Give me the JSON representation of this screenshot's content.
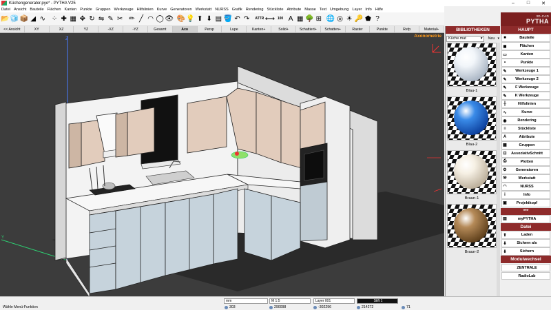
{
  "window": {
    "title": "Küchengenerator.pyo* - PYTHA V25",
    "controls": [
      "–",
      "□",
      "✕"
    ]
  },
  "menu": [
    "Datei",
    "Ansicht",
    "Bauteile",
    "Flächen",
    "Kanten",
    "Punkte",
    "Gruppen",
    "Werkzeuge",
    "Hilfslinien",
    "Kurve",
    "Generatoren",
    "Werkstatt",
    "NURSS",
    "Grafik",
    "Rendering",
    "Stückliste",
    "Attribute",
    "Masse",
    "Text",
    "Umgebung",
    "Layer",
    "Info",
    "Hilfe"
  ],
  "toolbar": [
    {
      "name": "open-icon",
      "glyph": "📂"
    },
    {
      "name": "cube-icon",
      "glyph": "🧊"
    },
    {
      "name": "box-icon",
      "glyph": "📦"
    },
    {
      "name": "surface-icon",
      "glyph": "◢"
    },
    {
      "name": "curve-icon",
      "glyph": "∿"
    },
    {
      "name": "sep"
    },
    {
      "name": "points-icon",
      "glyph": "⁘"
    },
    {
      "name": "snap-icon",
      "glyph": "✚"
    },
    {
      "name": "group-icon",
      "glyph": "▦"
    },
    {
      "name": "move-icon",
      "glyph": "✥"
    },
    {
      "name": "rotate-icon",
      "glyph": "↻"
    },
    {
      "name": "mirror-icon",
      "glyph": "⇋"
    },
    {
      "name": "edit-icon",
      "glyph": "✎"
    },
    {
      "name": "cut-icon",
      "glyph": "✂"
    },
    {
      "name": "sep"
    },
    {
      "name": "pencil-icon",
      "glyph": "✏"
    },
    {
      "name": "line-icon",
      "glyph": "╱"
    },
    {
      "name": "arc-icon",
      "glyph": "◠"
    },
    {
      "name": "circle-icon",
      "glyph": "◯"
    },
    {
      "name": "eye-icon",
      "glyph": "👁"
    },
    {
      "name": "sep"
    },
    {
      "name": "render-icon",
      "glyph": "🎨"
    },
    {
      "name": "light-icon",
      "glyph": "💡"
    },
    {
      "name": "up-arrow-icon",
      "glyph": "⬆"
    },
    {
      "name": "down-arrow-icon",
      "glyph": "⬇"
    },
    {
      "name": "layers-icon",
      "glyph": "▤"
    },
    {
      "name": "bucket-icon",
      "glyph": "🪣"
    },
    {
      "name": "undo-icon",
      "glyph": "↶"
    },
    {
      "name": "redo-icon",
      "glyph": "↷"
    },
    {
      "name": "sep"
    },
    {
      "name": "attr-icon",
      "glyph": "ATTR",
      "txt": true
    },
    {
      "name": "dimension-icon",
      "glyph": "⟷"
    },
    {
      "name": "number-icon",
      "glyph": "100",
      "txt": true
    },
    {
      "name": "text-icon",
      "glyph": "A"
    },
    {
      "name": "table-icon",
      "glyph": "▦"
    },
    {
      "name": "tree-icon",
      "glyph": "🌳"
    },
    {
      "name": "grid-icon",
      "glyph": "⊞"
    },
    {
      "name": "sep"
    },
    {
      "name": "globe-icon",
      "glyph": "🌐"
    },
    {
      "name": "target-icon",
      "glyph": "◎"
    },
    {
      "name": "sun-icon",
      "glyph": "☀"
    },
    {
      "name": "key-icon",
      "glyph": "🔑"
    },
    {
      "name": "shape-icon",
      "glyph": "⬟"
    },
    {
      "name": "question-icon",
      "glyph": "?"
    }
  ],
  "viewbar": [
    "<< Ansicht",
    "XY",
    "XZ",
    "YZ",
    "-XZ",
    "-YZ",
    "Gesamt",
    "Axo",
    "Persp",
    "Lupe",
    "Kanten+",
    "Solid+",
    "Schattiert+",
    "Schatten+",
    "Raster",
    "Punkte",
    "Refp",
    "Material+"
  ],
  "viewbar_active": "Axo",
  "viewport": {
    "title": "Axonometrie",
    "axis_labels": {
      "z": "Z",
      "y": "Y"
    }
  },
  "biblio": {
    "header": "BIBLIOTHEKEN",
    "file": "Küche.mat",
    "new_label": "Neu",
    "materials": [
      {
        "label": "Blau-1",
        "color": "#f2f6fa",
        "shade": "#a7b3c2"
      },
      {
        "label": "Blau-2",
        "color": "#3a8be8",
        "shade": "#0a3c9a"
      },
      {
        "label": "Braun-1",
        "color": "#f6f0e4",
        "shade": "#b8ab96"
      },
      {
        "label": "Braun-2",
        "color": "#b58a58",
        "shade": "#5a3c18"
      }
    ]
  },
  "haupt": {
    "logo_line1": "3D-CAD",
    "logo_line2": "PYTHA",
    "header": "HAUPT",
    "buttons": [
      {
        "label": "Bauteile",
        "icon": "cube-icon",
        "glyph": "■"
      },
      {
        "label": "Flächen",
        "icon": "surface-icon",
        "glyph": "◼"
      },
      {
        "label": "Kanten",
        "icon": "edge-icon",
        "glyph": "▭"
      },
      {
        "label": "Punkte",
        "icon": "point-icon",
        "glyph": "•"
      },
      {
        "label": "Werkzeuge 1",
        "icon": "tool-icon",
        "glyph": "✎"
      },
      {
        "label": "Werkzeuge 2",
        "icon": "tool2-icon",
        "glyph": "✎"
      },
      {
        "label": "F Werkzeuge",
        "icon": "ftool-icon",
        "glyph": "✎"
      },
      {
        "label": "K Werkzeuge",
        "icon": "ktool-icon",
        "glyph": "✎"
      },
      {
        "label": "Hilfslinien",
        "icon": "guide-icon",
        "glyph": "╫"
      },
      {
        "label": "Kurve",
        "icon": "curve-icon",
        "glyph": "∿"
      },
      {
        "label": "Rendering",
        "icon": "render-icon",
        "glyph": "◉"
      },
      {
        "label": "Stückliste",
        "icon": "list-icon",
        "glyph": "≡"
      },
      {
        "label": "Attribute",
        "icon": "attribute-icon",
        "glyph": "A"
      },
      {
        "label": "Gruppen",
        "icon": "group-icon",
        "glyph": "▦"
      },
      {
        "label": "AssoziativSchnitt",
        "icon": "section-icon",
        "glyph": "⊡"
      },
      {
        "label": "Plotten",
        "icon": "plot-icon",
        "glyph": "⎙"
      },
      {
        "label": "Generatoren",
        "icon": "generator-icon",
        "glyph": "⚙"
      },
      {
        "label": "Werkstatt",
        "icon": "workshop-icon",
        "glyph": "⚒"
      },
      {
        "label": "NURSS",
        "icon": "nurss-icon",
        "glyph": "◠"
      },
      {
        "label": "Info",
        "icon": "info-icon",
        "glyph": "i"
      },
      {
        "label": "Projektkopf",
        "icon": "project-icon",
        "glyph": "▣"
      }
    ],
    "stars": "***",
    "mypytha": {
      "label": "myPYTHA",
      "icon": "mypytha-icon",
      "glyph": "▤"
    },
    "datei_header": "Datei",
    "datei_buttons": [
      {
        "label": "Laden",
        "icon": "load-icon",
        "glyph": "⬆"
      },
      {
        "label": "Sichern als",
        "icon": "save-as-icon",
        "glyph": "⬇"
      },
      {
        "label": "Sichern",
        "icon": "save-icon",
        "glyph": "⬇"
      }
    ],
    "modul_header": "Modulwechsel",
    "modul_buttons": [
      {
        "label": "ZENTRALE"
      },
      {
        "label": "RadioLab"
      }
    ]
  },
  "status": {
    "units": "mm",
    "scale": "M 1:5",
    "layer": "Layer 001",
    "style": "Stift 1",
    "message": "Wähle Menü-Funktion",
    "count": "303",
    "x": "290098",
    "y": "-302296",
    "z": "214272",
    "angle": "71"
  }
}
